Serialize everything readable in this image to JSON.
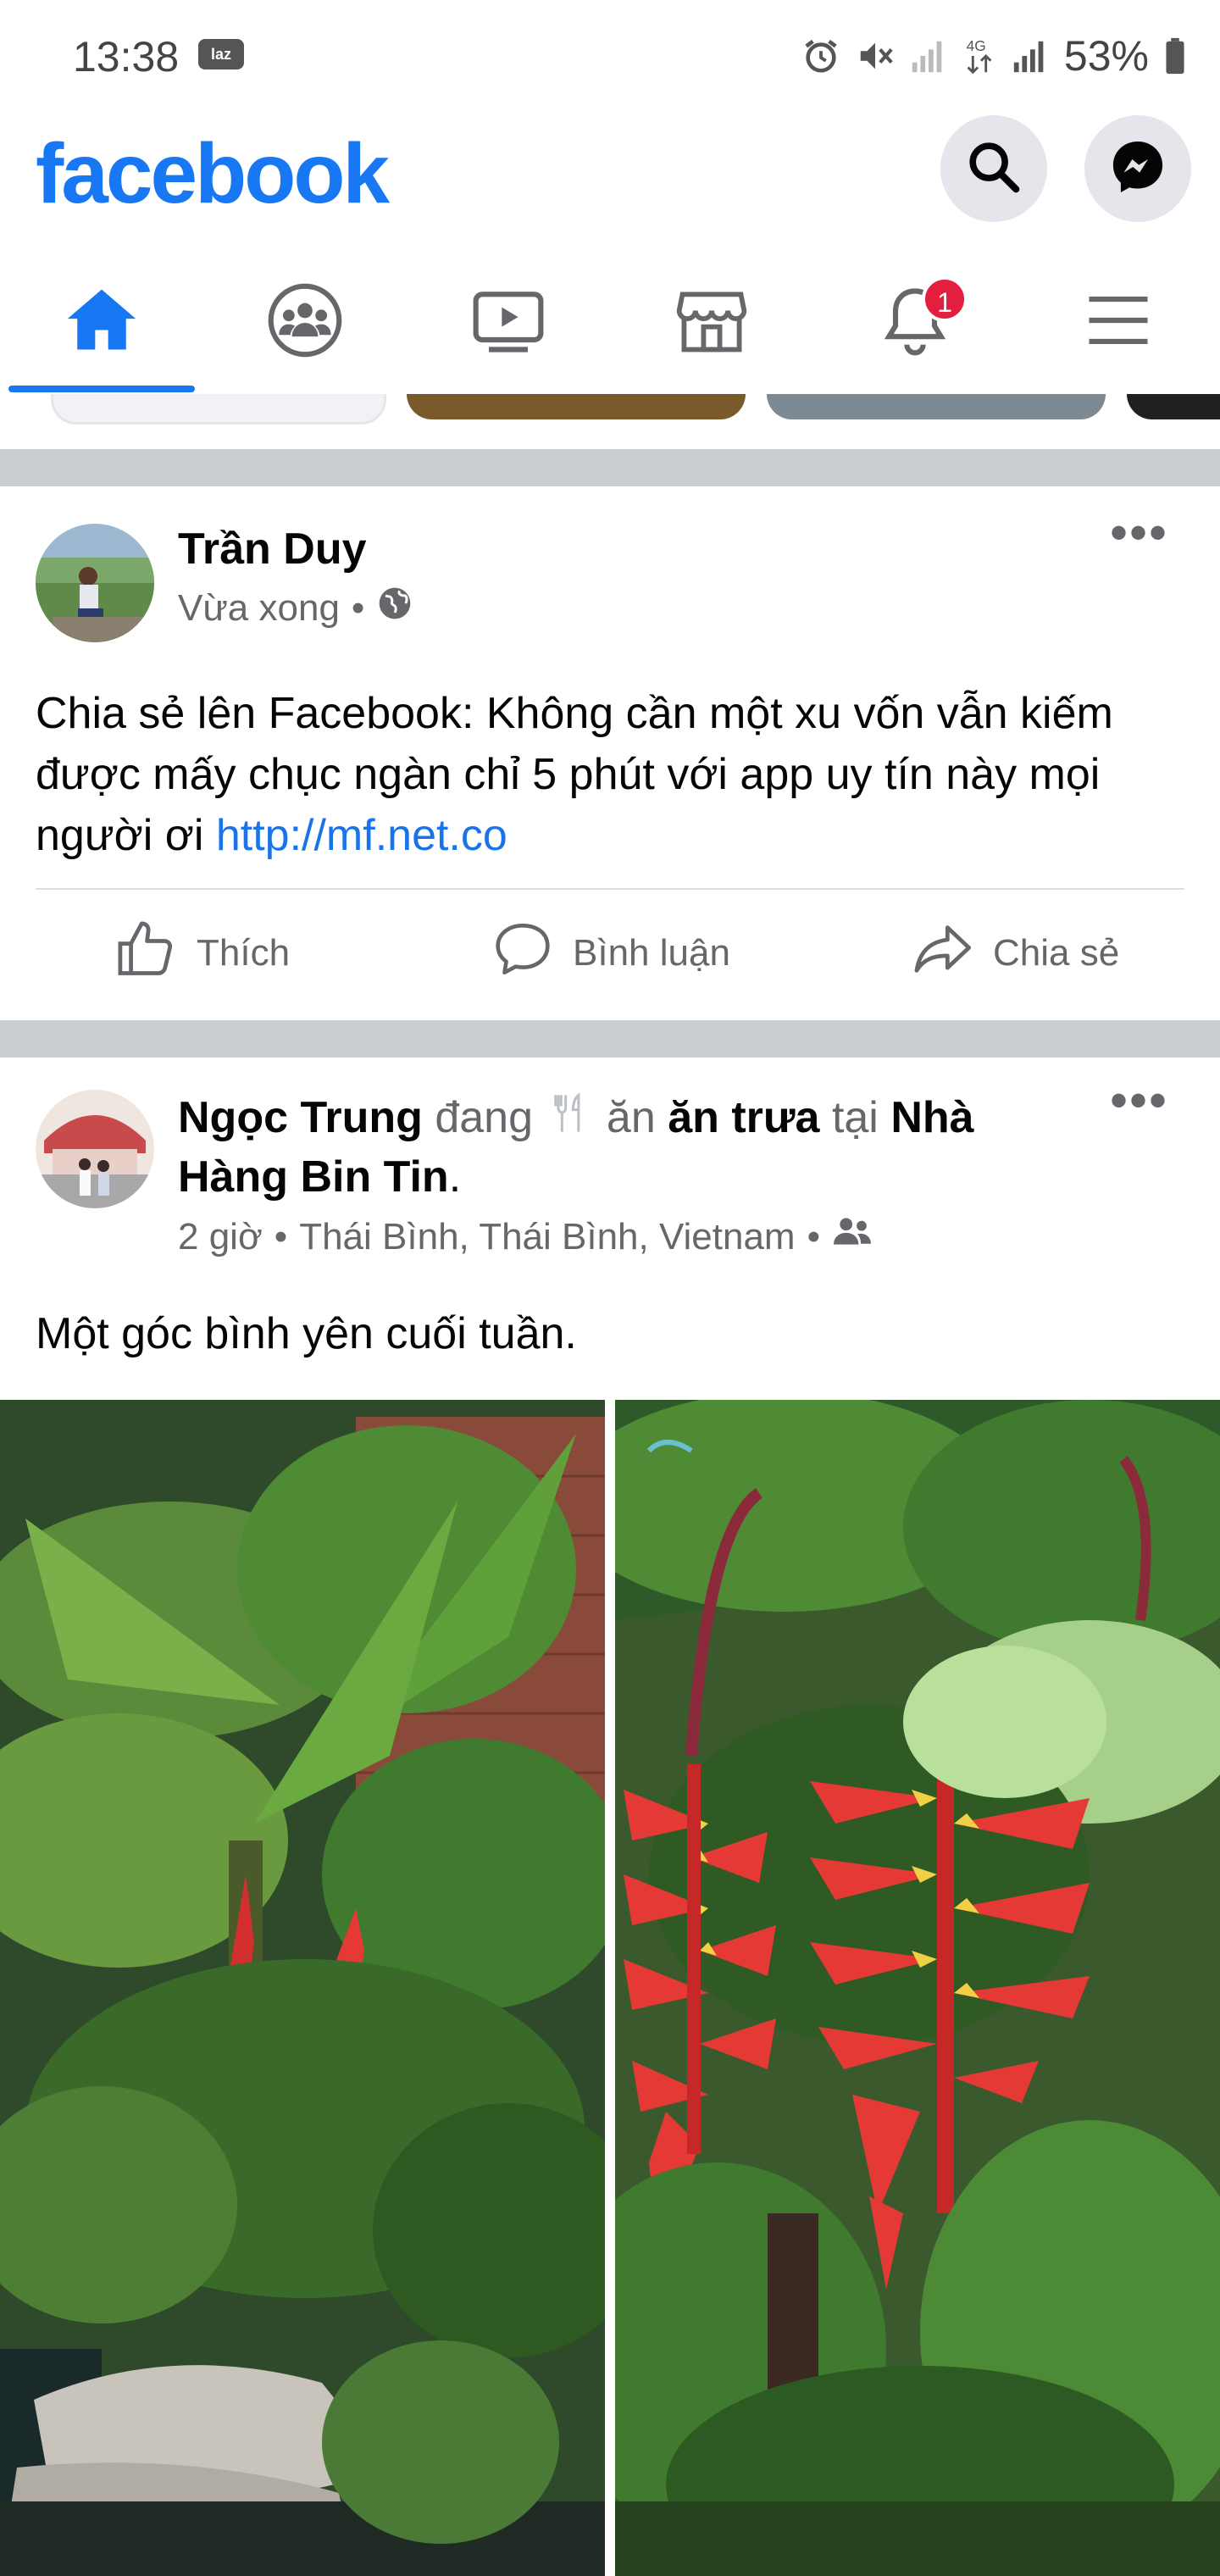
{
  "status_bar": {
    "time": "13:38",
    "carrier_badge": "laz",
    "network": "4G",
    "battery": "53%",
    "icons": [
      "alarm-icon",
      "vibrate-icon",
      "signal-icon",
      "4g-icon",
      "signal-icon",
      "battery-icon"
    ]
  },
  "header": {
    "logo": "facebook",
    "brand_color": "#1877f2",
    "actions": [
      "search-icon",
      "messenger-icon"
    ]
  },
  "tabs": {
    "items": [
      "home-icon",
      "groups-icon",
      "watch-icon",
      "marketplace-icon",
      "notifications-icon",
      "menu-icon"
    ],
    "active": "home",
    "notifications_badge": "1"
  },
  "posts": [
    {
      "author": "Trần Duy",
      "time": "Vừa xong",
      "separator": "•",
      "privacy_icon": "globe-icon",
      "text_main": "Chia sẻ lên Facebook: Không cần một xu vốn vẫn kiếm được mấy chục ngàn chỉ 5 phút với app uy tín này mọi người ơi ",
      "link": "http://mf.net.co",
      "actions": {
        "like": "Thích",
        "comment": "Bình luận",
        "share": "Chia sẻ"
      }
    },
    {
      "author": "Ngọc Trung",
      "verb": "đang",
      "activity_icon": "fork-knife-icon",
      "activity": "ăn",
      "activity_bold": "ăn trưa",
      "at": "tại",
      "place": "Nhà Hàng Bin Tin",
      "period": ".",
      "time": "2 giờ",
      "location": "Thái Bình, Thái Bình, Vietnam",
      "separator": "•",
      "privacy_icon": "friends-icon",
      "text": "Một góc bình yên cuối tuần."
    }
  ]
}
